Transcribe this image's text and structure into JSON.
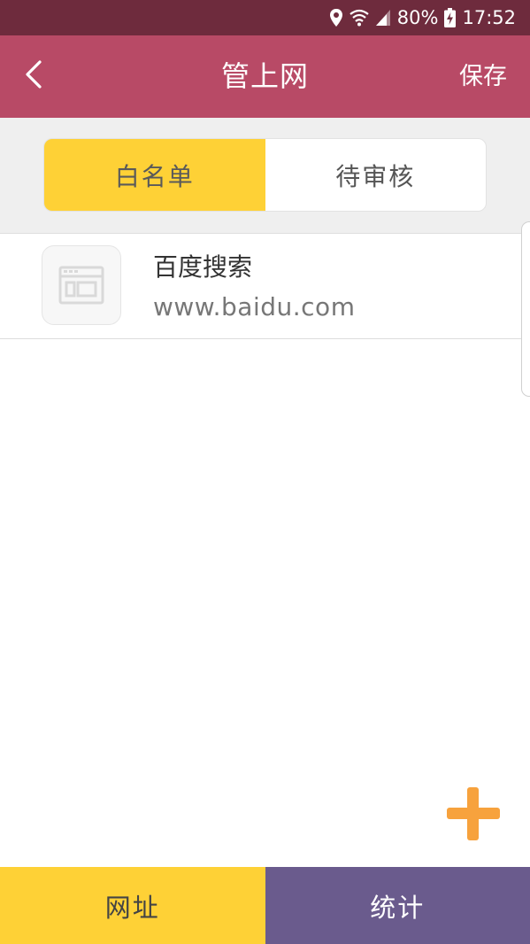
{
  "status_bar": {
    "battery": "80%",
    "time": "17:52",
    "icons": [
      "location-icon",
      "wifi-icon",
      "signal-icon",
      "battery-charging-icon"
    ]
  },
  "header": {
    "title": "管上网",
    "save_label": "保存",
    "back_icon": "chevron-left-icon"
  },
  "segments": {
    "items": [
      {
        "label": "白名单",
        "active": true
      },
      {
        "label": "待审核",
        "active": false
      }
    ]
  },
  "sites": [
    {
      "name": "百度搜索",
      "url": "www.baidu.com",
      "icon": "browser-window-icon"
    }
  ],
  "fab": {
    "icon": "plus-icon"
  },
  "bottom_tabs": [
    {
      "label": "网址"
    },
    {
      "label": "统计"
    }
  ],
  "colors": {
    "status_bar": "#6e2b3d",
    "header": "#b84a66",
    "accent_yellow": "#fed136",
    "accent_purple": "#6a5b8d",
    "fab_orange": "#f7a23d"
  }
}
